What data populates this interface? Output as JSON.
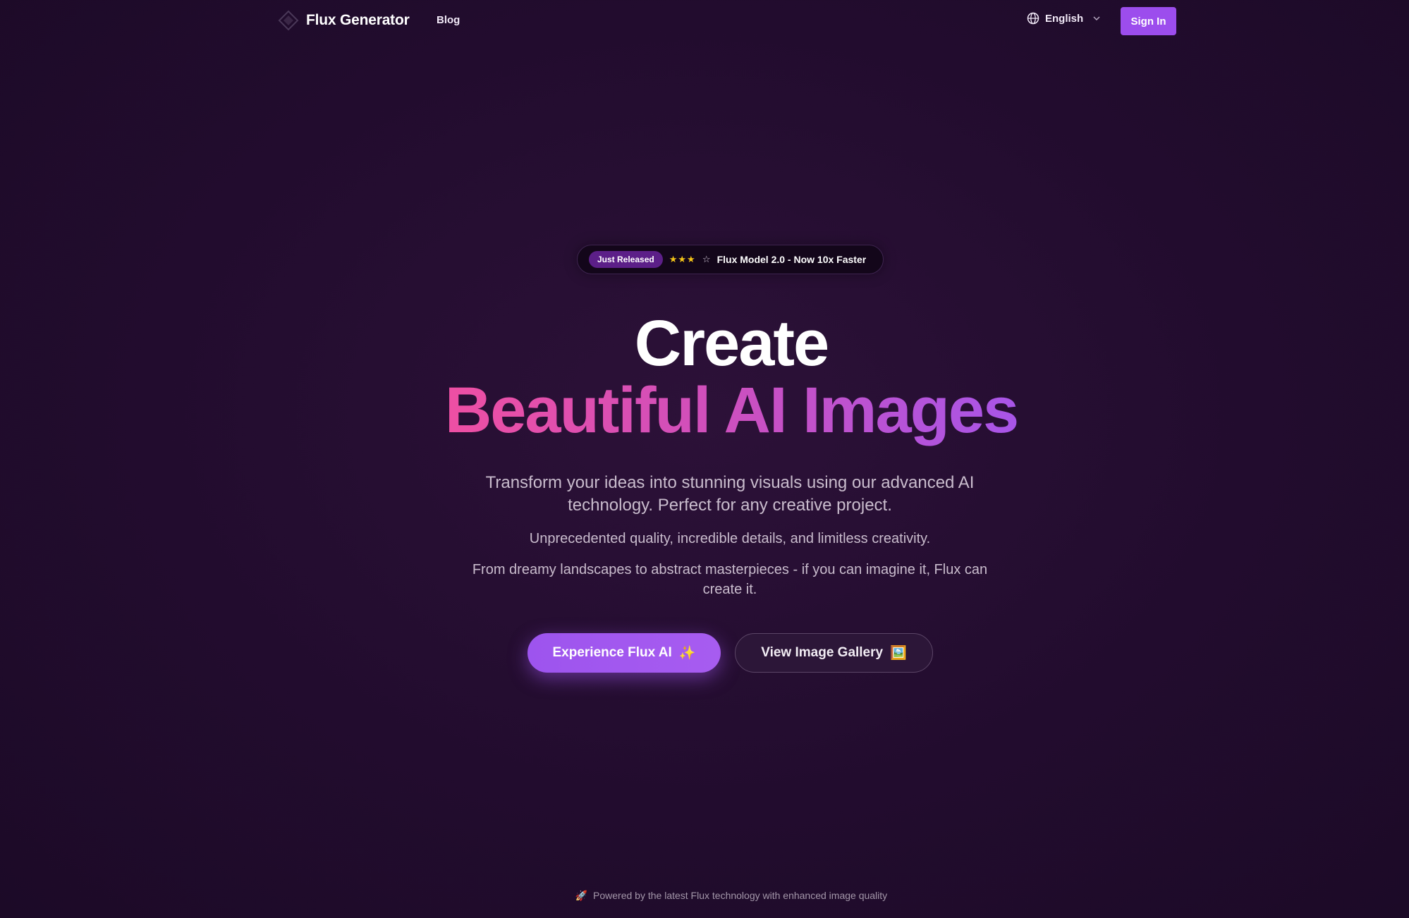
{
  "nav": {
    "brand": "Flux Generator",
    "logo_icon": "diamond-logo-icon",
    "links": [
      {
        "label": "Blog"
      }
    ],
    "language": {
      "icon": "globe-icon",
      "selected": "English",
      "chevron": "chevron-down-icon"
    },
    "signin_label": "Sign In"
  },
  "badge": {
    "pill": "Just Released",
    "stars_filled": "★★★",
    "stars_empty": "☆",
    "text": "Flux Model 2.0 - Now 10x Faster",
    "rating": {
      "filled": 3,
      "total": 4
    }
  },
  "hero": {
    "line1": "Create",
    "line2": "Beautiful AI Images",
    "subtitle": "Transform your ideas into stunning visuals using our advanced AI technology. Perfect for any creative project.",
    "tagline": "Unprecedented quality, incredible details, and limitless creativity.",
    "description": "From dreamy landscapes to abstract masterpieces - if you can imagine it, Flux can create it."
  },
  "cta": {
    "primary_label": "Experience Flux AI",
    "primary_emoji": "✨",
    "secondary_label": "View Image Gallery",
    "secondary_emoji": "🖼️"
  },
  "footer": {
    "icon": "🚀",
    "note": "Powered by the latest Flux technology with enhanced image quality"
  },
  "colors": {
    "background": "#220c2e",
    "accent": "#9c4ded",
    "gradient_start": "#ee4fa3",
    "gradient_end": "#a855e8",
    "star": "#f5c518"
  }
}
